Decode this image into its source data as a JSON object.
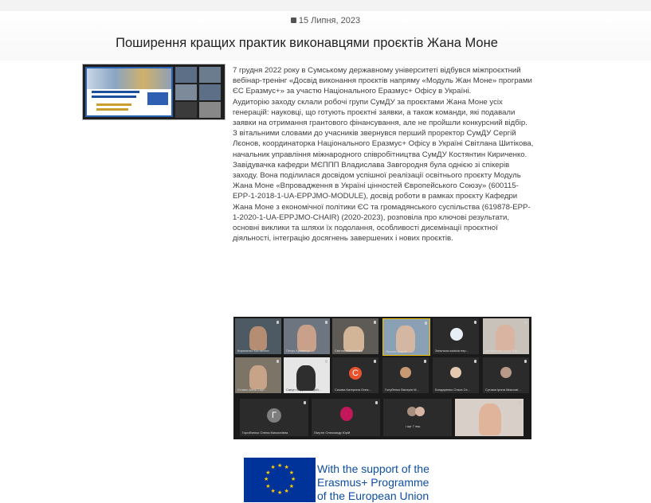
{
  "date": "15 Липня, 2023",
  "title": "Поширення кращих практик виконавцями проєктів Жана Моне",
  "paragraphs": [
    "7 грудня 2022 року в Сумському державному університеті відбувся міжпроєктний вебінар-тренінг «Досвід виконання проєктів напряму «Модуль Жан Моне» програми ЄС Еразмус+» за участю Національного Еразмус+ Офісу в Україні.",
    "Аудиторію заходу склали робочі групи СумДУ за проєктами Жана Моне усіх генерацій: науковці, що готують проєктні заявки, а також команди, які подавали заявки на отримання грантового фінансування, але не пройшли конкурсний відбір. З вітальними словами до учасників звернувся перший проректор СумДУ Сергій Лєонов, координаторка Національного Еразмус+ Офісу в Україні Світлана Шитікова, начальник управління міжнародного співробітництва СумДУ Костянтин Кириченко.",
    "Завідувачка кафедри МЄППП Владислава Завгородня була однією зі спікерів заходу. Вона поділилася досвідом успішної реалізації освітнього проєкту Модуль Жана Моне «Впровадження в Україні цінностей Європейського Союзу» (600115-EPP-1-2018-1-UA-EPPJMO-MODULE), досвід роботи в рамках проєкту Кафедри Жана Моне з економічної політики ЄС та громадянського суспільства (619878-EPP-1-2020-1-UA-EPPJMO-CHAIR) (2020-2023), розповіла про ключові результати, основні виклики та шляхи їх подолання, особливості дисемінації проєктної діяльності, інтеграцію досягнень завершених і нових проєктів."
  ],
  "meeting": {
    "tiles": [
      {
        "name": "Кириченко Костянтин"
      },
      {
        "name": "Петро Кулявець"
      },
      {
        "name": "Світлана Шитікова"
      },
      {
        "name": "Лєонов Сергій"
      },
      {
        "name": "Загальна комісія пер..."
      },
      {
        "name": "Дегтярьова Ірина Бор..."
      },
      {
        "name": "Стовпо Анна Серг..."
      },
      {
        "name": "Сапун Людмила Юрій..."
      },
      {
        "name": "Сизова Катерина Олек...",
        "initial": "С"
      },
      {
        "name": "Голубенко Валерія М..."
      },
      {
        "name": "Бондаренко Ольга Се..."
      },
      {
        "name": "Сутама Ірина Миколаї..."
      },
      {
        "name": "Горобченко Олена Миколаївна",
        "initial": "Г"
      },
      {
        "name": "Лагутін Олександр Юрій"
      },
      {
        "name": "і ще 7 інш."
      },
      {
        "name": ""
      }
    ]
  },
  "eu_logo_text": [
    "With the support of the",
    "Erasmus+ Programme",
    "of the European Union"
  ],
  "colors": {
    "eu_blue": "#003399",
    "eu_star": "#ffcc00",
    "eu_text": "#0e4ea3"
  }
}
